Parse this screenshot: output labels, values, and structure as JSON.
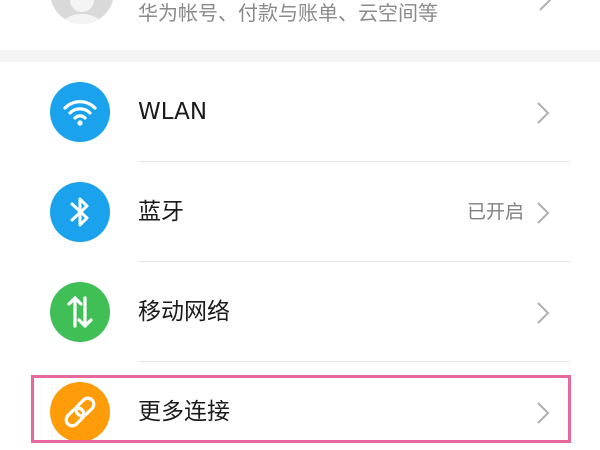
{
  "account": {
    "subtitle": "华为帐号、付款与账单、云空间等"
  },
  "settings": {
    "items": [
      {
        "label": "WLAN",
        "status": "",
        "icon": "wifi-icon",
        "color": "#1aa3ec"
      },
      {
        "label": "蓝牙",
        "status": "已开启",
        "icon": "bluetooth-icon",
        "color": "#1aa3ec"
      },
      {
        "label": "移动网络",
        "status": "",
        "icon": "mobile-data-icon",
        "color": "#3fbf56"
      },
      {
        "label": "更多连接",
        "status": "",
        "icon": "link-icon",
        "color": "#ff9c0a"
      }
    ]
  },
  "colors": {
    "highlight": "#e7689b",
    "background": "#f3f3f3"
  }
}
